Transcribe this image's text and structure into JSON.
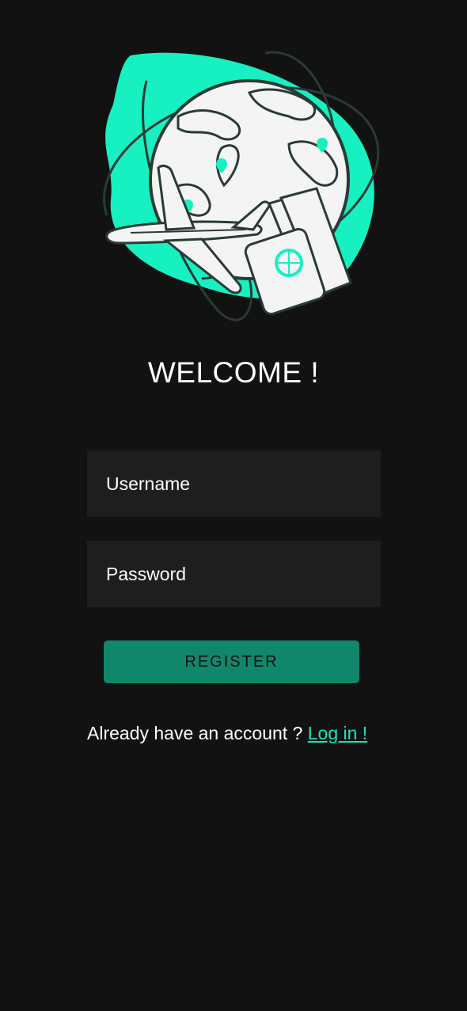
{
  "header": {
    "title": "WELCOME !"
  },
  "form": {
    "username_placeholder": "Username",
    "password_placeholder": "Password",
    "register_label": "REGISTER"
  },
  "footer": {
    "prompt": "Already have an account ?",
    "login_link": "Log in !"
  },
  "theme": {
    "background": "#121212",
    "field_background": "#1e1e1e",
    "accent": "#17e6b8",
    "button": "#10876b"
  },
  "illustration": {
    "icon": "travel-globe-illustration"
  }
}
